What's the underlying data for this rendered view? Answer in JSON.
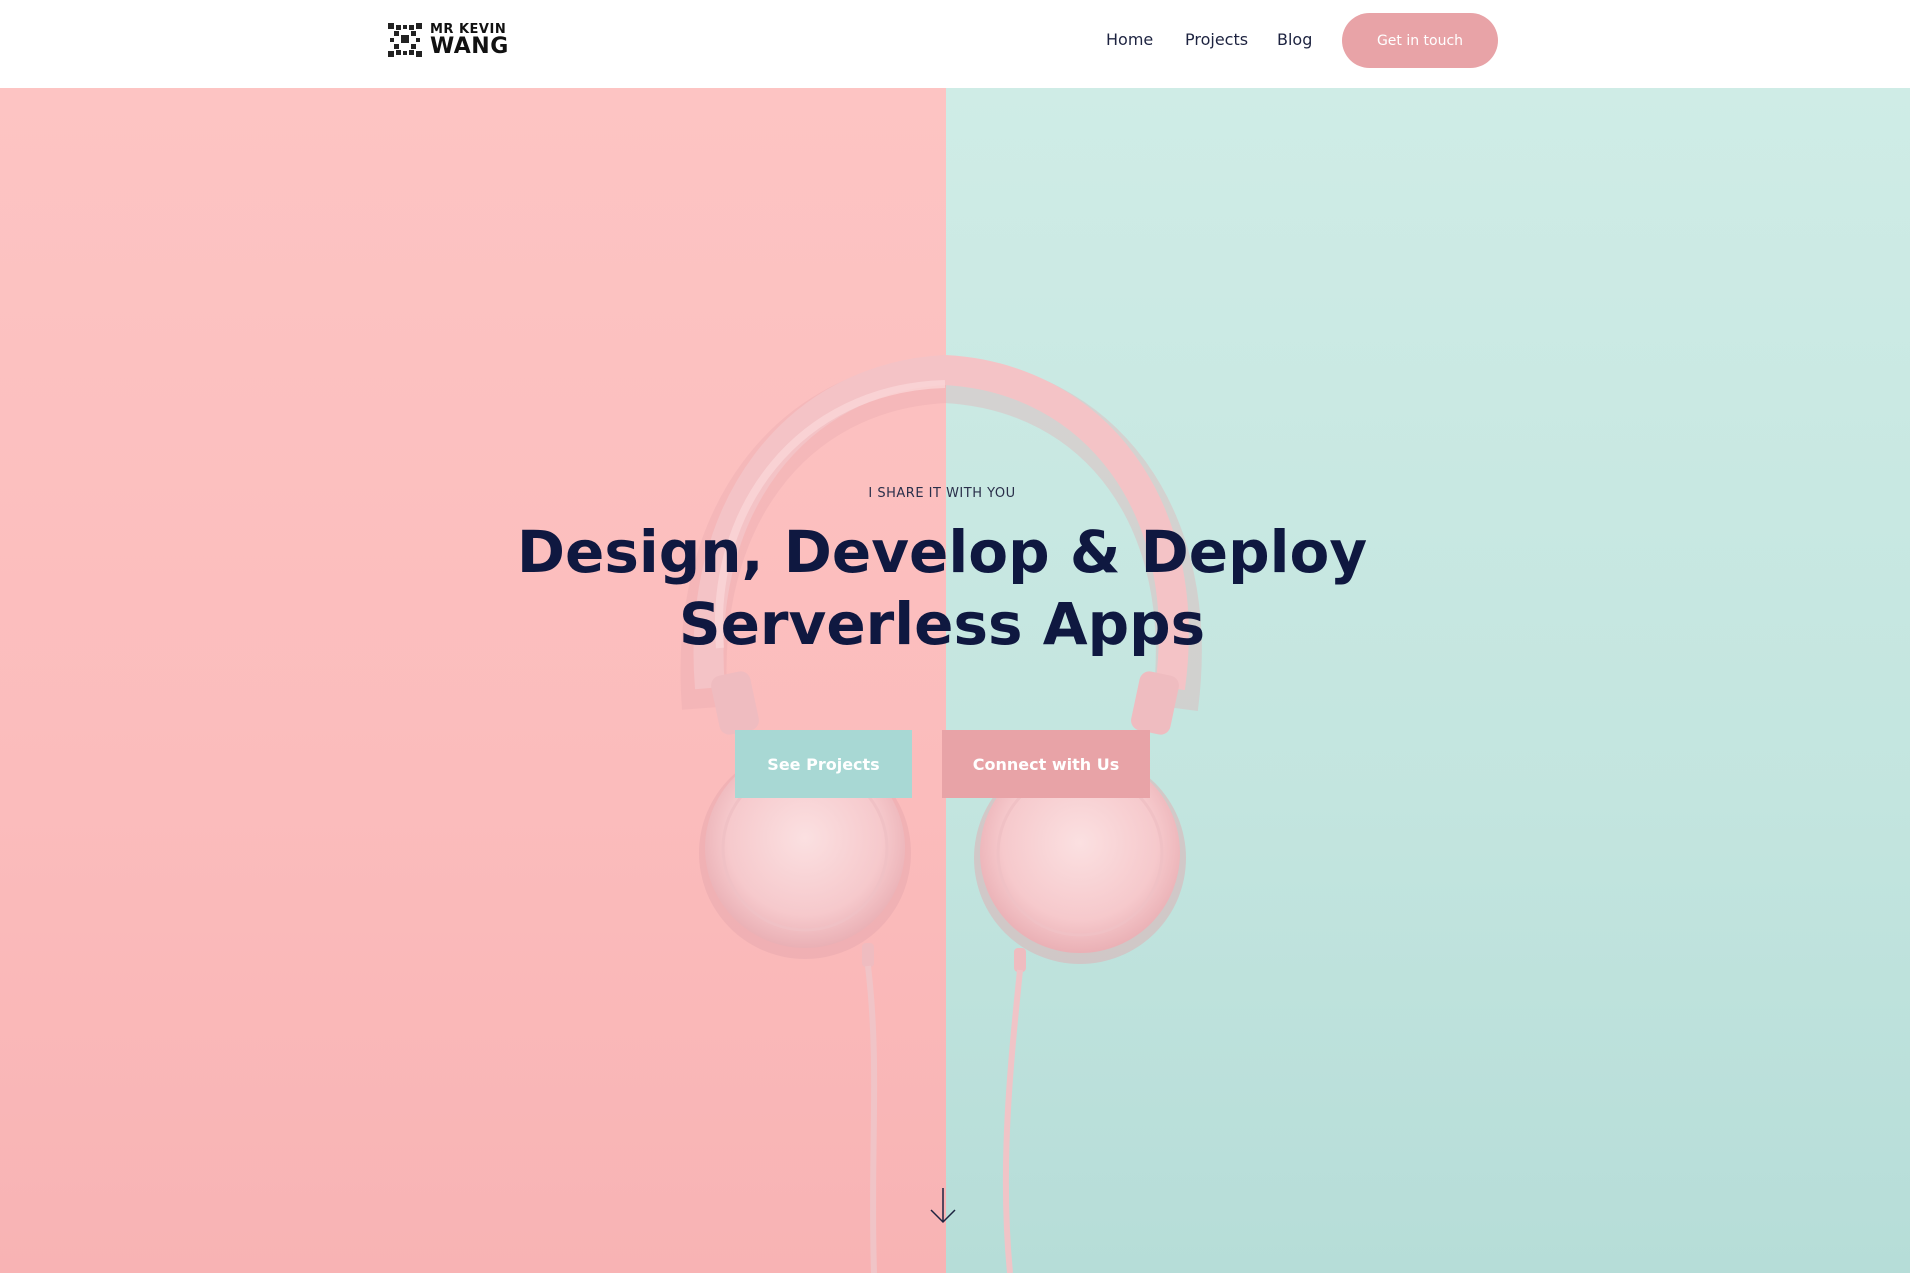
{
  "header": {
    "logo_line1": "MR KEVIN",
    "logo_line2": "WANG",
    "nav": [
      {
        "label": "Home"
      },
      {
        "label": "Projects"
      },
      {
        "label": "Blog"
      }
    ],
    "cta_label": "Get in touch"
  },
  "hero": {
    "eyebrow": "I SHARE IT WITH YOU",
    "headline_line1": "Design, Develop & Deploy",
    "headline_line2": "Serverless Apps",
    "primary_button": "See Projects",
    "secondary_button": "Connect with Us",
    "scroll_icon": "arrow-down-icon"
  },
  "colors": {
    "accent_pink": "#e8a3a7",
    "accent_teal": "#a8d8d4",
    "headline": "#0f1840",
    "bg_pink": "#fdc4c3",
    "bg_teal": "#cfece6"
  }
}
